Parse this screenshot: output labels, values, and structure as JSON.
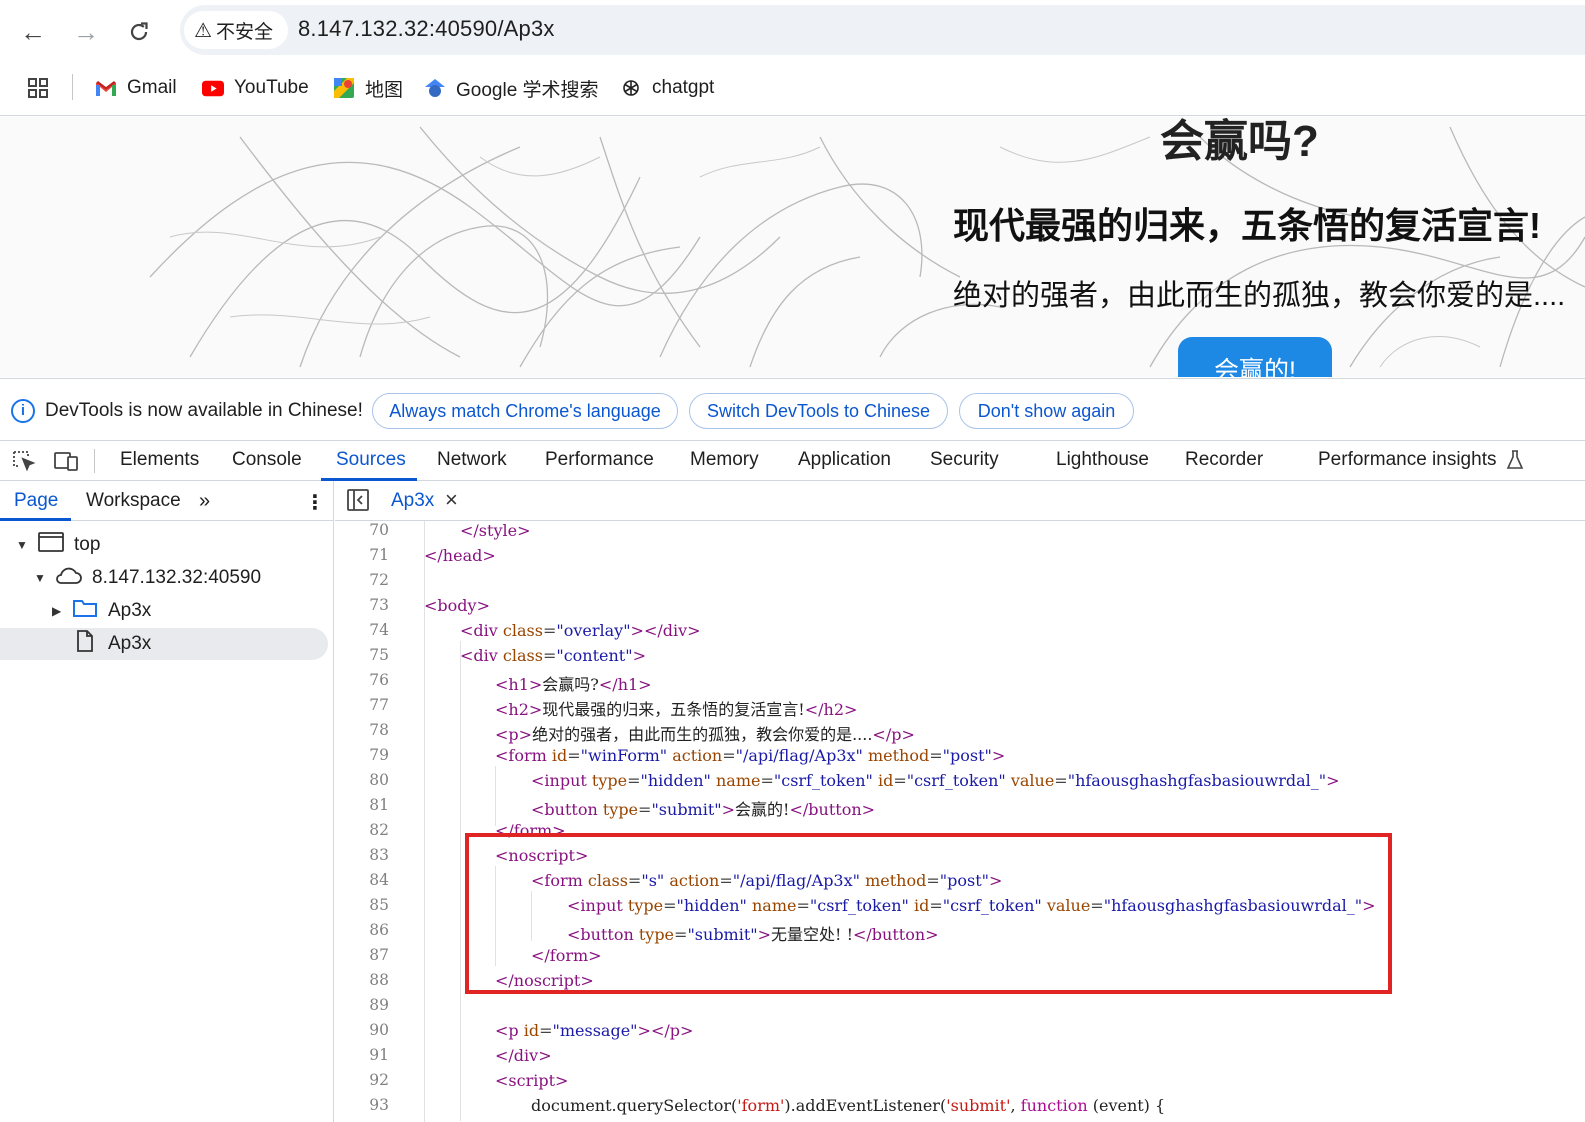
{
  "browser": {
    "security_label": "不安全",
    "url": "8.147.132.32:40590/Ap3x",
    "bookmarks": [
      {
        "label": "Gmail",
        "icon": "gmail-icon"
      },
      {
        "label": "YouTube",
        "icon": "youtube-icon"
      },
      {
        "label": "地图",
        "icon": "maps-icon"
      },
      {
        "label": "Google 学术搜索",
        "icon": "scholar-icon"
      },
      {
        "label": "chatgpt",
        "icon": "chatgpt-icon"
      }
    ]
  },
  "page": {
    "h1": "会赢吗?",
    "h2": "现代最强的归来，五条悟的复活宣言!",
    "p": "绝对的强者，由此而生的孤独，教会你爱的是....",
    "button": "会赢的!"
  },
  "infobar": {
    "message": "DevTools is now available in Chinese!",
    "btn_match": "Always match Chrome's language",
    "btn_switch": "Switch DevTools to Chinese",
    "btn_dont": "Don't show again"
  },
  "devtools_tabs": [
    "Elements",
    "Console",
    "Sources",
    "Network",
    "Performance",
    "Memory",
    "Application",
    "Security",
    "Lighthouse",
    "Recorder",
    "Performance insights"
  ],
  "sources": {
    "subtabs": {
      "page": "Page",
      "workspace": "Workspace"
    },
    "tree": {
      "top": "top",
      "host": "8.147.132.32:40590",
      "folder": "Ap3x",
      "file": "Ap3x"
    },
    "open_file": "Ap3x"
  },
  "code": {
    "line_numbers": [
      "70",
      "71",
      "72",
      "73",
      "74",
      "75",
      "76",
      "77",
      "78",
      "79",
      "80",
      "81",
      "82",
      "83",
      "84",
      "85",
      "86",
      "87",
      "88",
      "89",
      "90",
      "91",
      "92",
      "93"
    ],
    "lines": {
      "l70": "</style>",
      "l71": "</head>",
      "l73": "<body>",
      "l74_class": "overlay",
      "l75_class": "content",
      "l76_text": "会赢吗?",
      "l77_text": "现代最强的归来，五条悟的复活宣言!",
      "l78_text": "绝对的强者，由此而生的孤独，教会你爱的是....",
      "l79_id": "winForm",
      "l79_action": "/api/flag/Ap3x",
      "l79_method": "post",
      "l80_type": "hidden",
      "l80_name": "csrf_token",
      "l80_id": "csrf_token",
      "l80_value": "hfaousghashgfasbasiouwrdal_",
      "l81_type": "submit",
      "l81_text": "会赢的!",
      "l84_class": "s",
      "l84_action": "/api/flag/Ap3x",
      "l84_method": "post",
      "l85_type": "hidden",
      "l85_name": "csrf_token",
      "l85_id": "csrf_token",
      "l85_value": "hfaousghashgfasbasiouwrdal_",
      "l86_type": "submit",
      "l86_text": "无量空处! !",
      "l90_id": "message",
      "l93_selector": "'form'",
      "l93_event": "'submit'"
    }
  },
  "colors": {
    "accent": "#0b57d0",
    "highlight_box": "#e02424",
    "page_button": "#1e88e5"
  }
}
